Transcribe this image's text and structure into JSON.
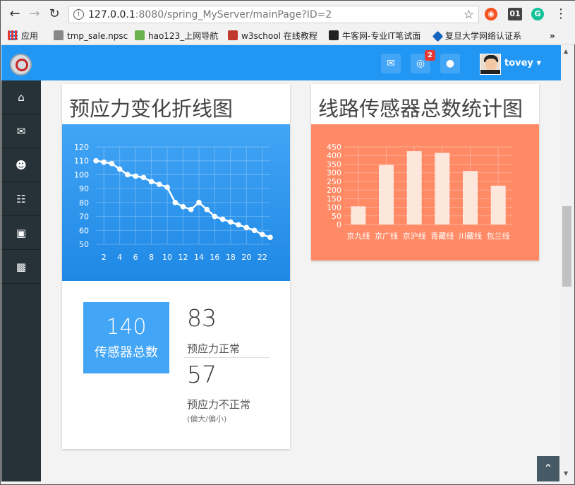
{
  "browser": {
    "url_host": "127.0.0.1",
    "url_rest": ":8080/spring_MyServer/mainPage?ID=2",
    "ext_label": "01",
    "bookmarks": [
      "应用",
      "tmp_sale.npsc",
      "hao123_上网导航",
      "w3school 在线教程",
      "牛客网-专业IT笔试面",
      "复旦大学网络认证系"
    ],
    "more": "»"
  },
  "header": {
    "badge_count": "2",
    "username": "tovey"
  },
  "sidebar": {
    "items": [
      {
        "icon": "home-icon"
      },
      {
        "icon": "envelope-icon"
      },
      {
        "icon": "user-icon"
      },
      {
        "icon": "sitemap-icon"
      },
      {
        "icon": "rss-icon"
      },
      {
        "icon": "bar-chart-icon"
      }
    ]
  },
  "cards": {
    "line_title": "预应力变化折线图",
    "bar_title": "线路传感器总数统计图",
    "total_value": "140",
    "total_label": "传感器总数",
    "normal_value": "83",
    "normal_label": "预应力正常",
    "abnormal_value": "57",
    "abnormal_label": "预应力不正常",
    "abnormal_note": "(偏大/偏小)"
  },
  "colors": {
    "primary": "#2196f3",
    "line_bg_top": "#42a5f5",
    "line_bg_bottom": "#1e88e5",
    "bar_bg": "#ff8a65",
    "sidebar": "#263238"
  },
  "chart_data": [
    {
      "type": "line",
      "x": [
        1,
        2,
        3,
        4,
        5,
        6,
        7,
        8,
        9,
        10,
        11,
        12,
        13,
        14,
        15,
        16,
        17,
        18,
        19,
        20,
        21,
        22,
        23
      ],
      "values": [
        110,
        109,
        108,
        104,
        100,
        99,
        98,
        95,
        93,
        91,
        80,
        77,
        75,
        80,
        75,
        70,
        68,
        66,
        64,
        62,
        60,
        57,
        55
      ],
      "x_ticks": [
        2,
        4,
        6,
        8,
        10,
        12,
        14,
        16,
        18,
        20,
        22
      ],
      "y_ticks": [
        50,
        60,
        70,
        80,
        90,
        100,
        110,
        120
      ],
      "ylim": [
        50,
        120
      ],
      "xlim": [
        1,
        23
      ],
      "grid": true
    },
    {
      "type": "bar",
      "categories": [
        "京九线",
        "京广线",
        "京沪线",
        "青藏线",
        "川藏线",
        "包兰线"
      ],
      "values": [
        105,
        345,
        425,
        415,
        310,
        225
      ],
      "y_ticks": [
        0,
        50,
        100,
        150,
        200,
        250,
        300,
        350,
        400,
        450
      ],
      "ylim": [
        0,
        450
      ],
      "grid": true
    }
  ]
}
